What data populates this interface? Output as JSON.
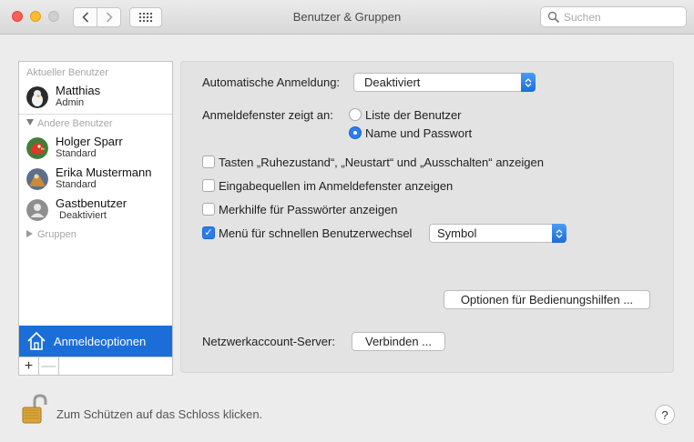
{
  "window": {
    "title": "Benutzer & Gruppen",
    "search_placeholder": "Suchen"
  },
  "sidebar": {
    "current_user_header": "Aktueller Benutzer",
    "current_user": {
      "name": "Matthias",
      "role": "Admin"
    },
    "other_users_header": "Andere Benutzer",
    "other_users": [
      {
        "name": "Holger Sparr",
        "role": "Standard"
      },
      {
        "name": "Erika Mustermann",
        "role": "Standard"
      },
      {
        "name": "Gastbenutzer",
        "role": "Deaktiviert"
      }
    ],
    "groups_label": "Gruppen",
    "login_options_label": "Anmeldeoptionen",
    "add_label": "+",
    "remove_label": "—"
  },
  "panel": {
    "auto_login_label": "Automatische Anmeldung:",
    "auto_login_value": "Deaktiviert",
    "login_window_label": "Anmeldefenster zeigt an:",
    "radio_options": [
      {
        "label": "Liste der Benutzer",
        "selected": false
      },
      {
        "label": "Name und Passwort",
        "selected": true
      }
    ],
    "checkboxes": [
      {
        "label": "Tasten „Ruhezustand“, „Neustart“ und „Ausschalten“ anzeigen",
        "checked": false
      },
      {
        "label": "Eingabequellen im Anmeldefenster anzeigen",
        "checked": false
      },
      {
        "label": "Merkhilfe für Passwörter anzeigen",
        "checked": false
      },
      {
        "label": "Menü für schnellen Benutzerwechsel",
        "checked": true
      }
    ],
    "fast_switch_value": "Symbol",
    "accessibility_button": "Optionen für Bedienungshilfen ...",
    "network_server_label": "Netzwerkaccount-Server:",
    "connect_button": "Verbinden ..."
  },
  "footer": {
    "lock_text": "Zum Schützen auf das Schloss klicken.",
    "help_label": "?"
  },
  "colors": {
    "accent": "#1b6ed8",
    "close": "#fd5f57",
    "minimize": "#febc2e"
  }
}
